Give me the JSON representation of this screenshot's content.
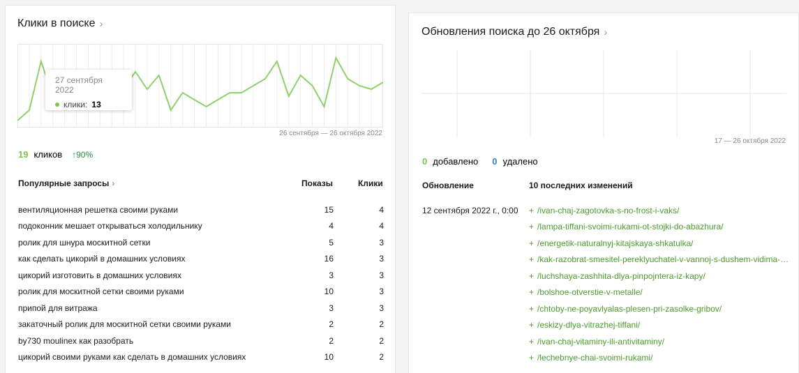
{
  "left": {
    "title": "Клики в поиске",
    "range": "26 сентября — 26 октября 2022",
    "tooltip": {
      "date": "27 сентября 2022",
      "label": "клики:",
      "value": "13"
    },
    "summary": {
      "count": "19",
      "label": "кликов",
      "growth": "↑90%"
    },
    "table": {
      "col_query": "Популярные запросы",
      "col_shows": "Показы",
      "col_clicks": "Клики",
      "rows": [
        {
          "query": "вентиляционная решетка своими руками",
          "shows": "15",
          "clicks": "4"
        },
        {
          "query": "подоконник мешает открываться холодильнику",
          "shows": "4",
          "clicks": "4"
        },
        {
          "query": "ролик для шнура москитной сетки",
          "shows": "5",
          "clicks": "3"
        },
        {
          "query": "как сделать цикорий в домашних условиях",
          "shows": "16",
          "clicks": "3"
        },
        {
          "query": "цикорий изготовить в домашних условиях",
          "shows": "3",
          "clicks": "3"
        },
        {
          "query": "ролик для москитной сетки своими руками",
          "shows": "10",
          "clicks": "3"
        },
        {
          "query": "припой для витража",
          "shows": "3",
          "clicks": "3"
        },
        {
          "query": "закаточный ролик для москитной сетки своими руками",
          "shows": "2",
          "clicks": "2"
        },
        {
          "query": "by730 moulinex как разобрать",
          "shows": "2",
          "clicks": "2"
        },
        {
          "query": "цикорий своими руками как сделать в домашних условиях",
          "shows": "10",
          "clicks": "2"
        }
      ]
    }
  },
  "right": {
    "title": "Обновления поиска до 26 октября",
    "range": "17 — 26 октября 2022",
    "summary": {
      "added_count": "0",
      "added_label": "добавлено",
      "removed_count": "0",
      "removed_label": "удалено"
    },
    "col_update": "Обновление",
    "col_changes": "10 последних изменений",
    "update_date": "12 сентября 2022 г., 0:00",
    "changes": [
      "/ivan-chaj-zagotovka-s-no-frost-i-vaks/",
      "/lampa-tiffani-svoimi-rukami-ot-stojki-do-abazhura/",
      "/energetik-naturalnyj-kitajskaya-shkatulka/",
      "/kak-razobrat-smesitel-pereklyuchatel-v-vannoj-s-dushem-vidima-v...",
      "/luchshaya-zashhita-dlya-pinpojntera-iz-kapy/",
      "/bolshoe-otverstie-v-metalle/",
      "/chtoby-ne-poyavlyalas-plesen-pri-zasolke-gribov/",
      "/eskizy-dlya-vitrazhej-tiffani/",
      "/ivan-chaj-vitaminy-ili-antivitaminy/",
      "/lechebnye-chai-svoimi-rukami/"
    ]
  },
  "chart_data": {
    "type": "line",
    "series": [
      {
        "values": [
          2,
          5,
          19,
          9,
          13,
          10,
          7,
          10,
          7,
          11,
          16,
          11,
          15,
          5,
          10,
          8,
          6,
          8,
          10,
          10,
          12,
          14,
          19,
          9,
          15,
          12,
          6,
          20,
          14,
          12,
          11,
          13
        ]
      }
    ],
    "ylim": [
      0,
      24
    ],
    "grid": true,
    "color": "#8fd06b"
  }
}
